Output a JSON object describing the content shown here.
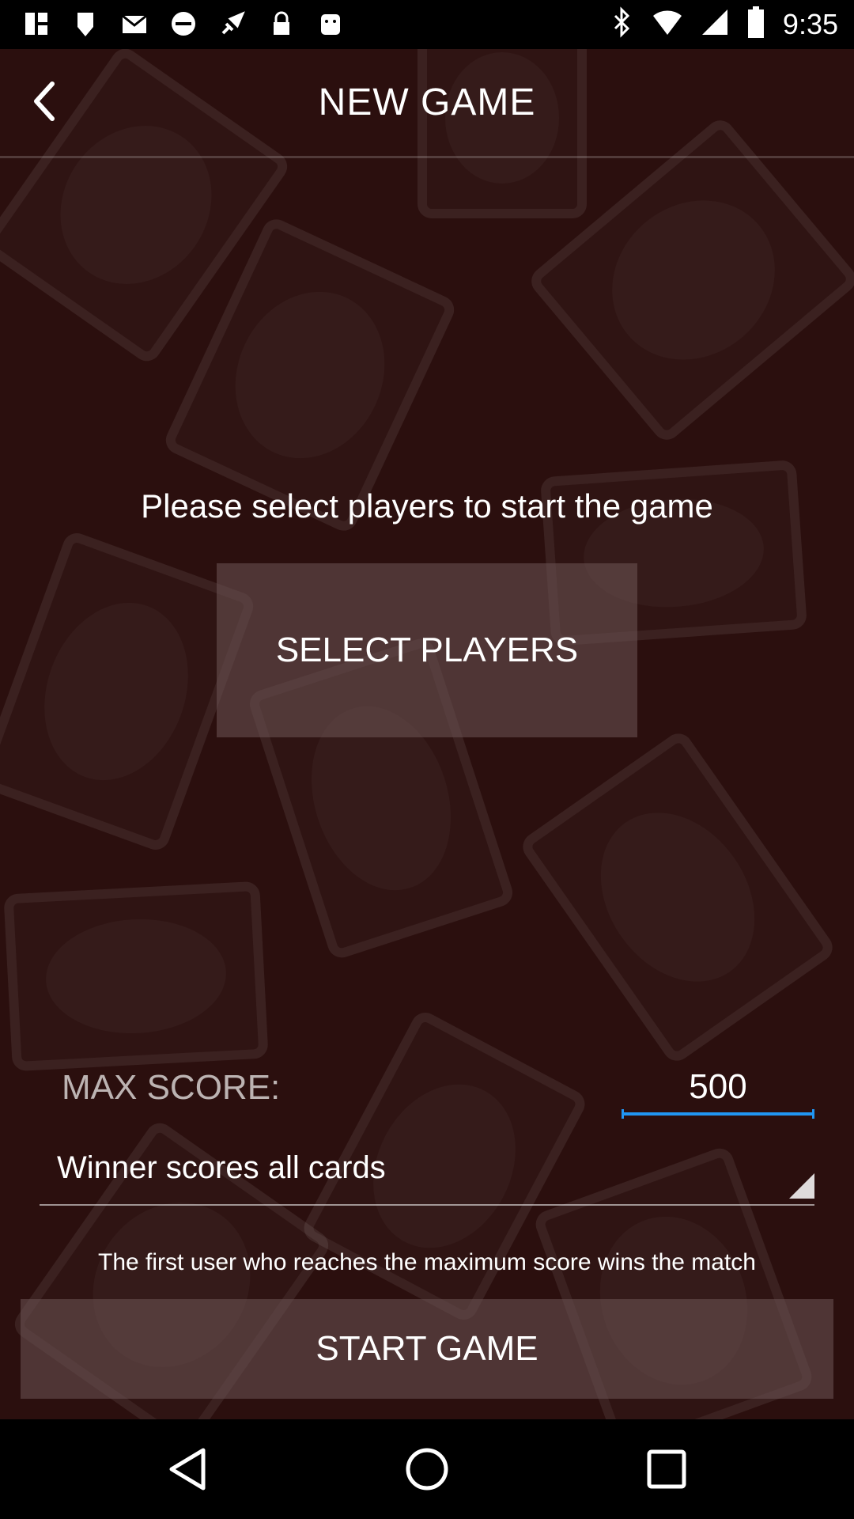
{
  "status_bar": {
    "time": "9:35",
    "left_icons": [
      "notification-icon",
      "notification-icon",
      "mail-icon",
      "blocked-icon",
      "fake-gps-icon",
      "lock-icon",
      "android-icon"
    ],
    "right_icons": [
      "bluetooth-icon",
      "wifi-icon",
      "signal-icon",
      "battery-icon"
    ]
  },
  "header": {
    "title": "NEW GAME"
  },
  "main": {
    "prompt": "Please select players to start the game",
    "select_players_label": "SELECT PLAYERS"
  },
  "settings": {
    "max_score_label": "MAX SCORE:",
    "max_score_value": "500",
    "rule_selected": "Winner scores all cards",
    "rule_description": "The first user who reaches the maximum score wins the match"
  },
  "actions": {
    "start_label": "START GAME"
  },
  "colors": {
    "background": "#2b0f0e",
    "button": "#6e5555",
    "accent": "#2196f3"
  }
}
